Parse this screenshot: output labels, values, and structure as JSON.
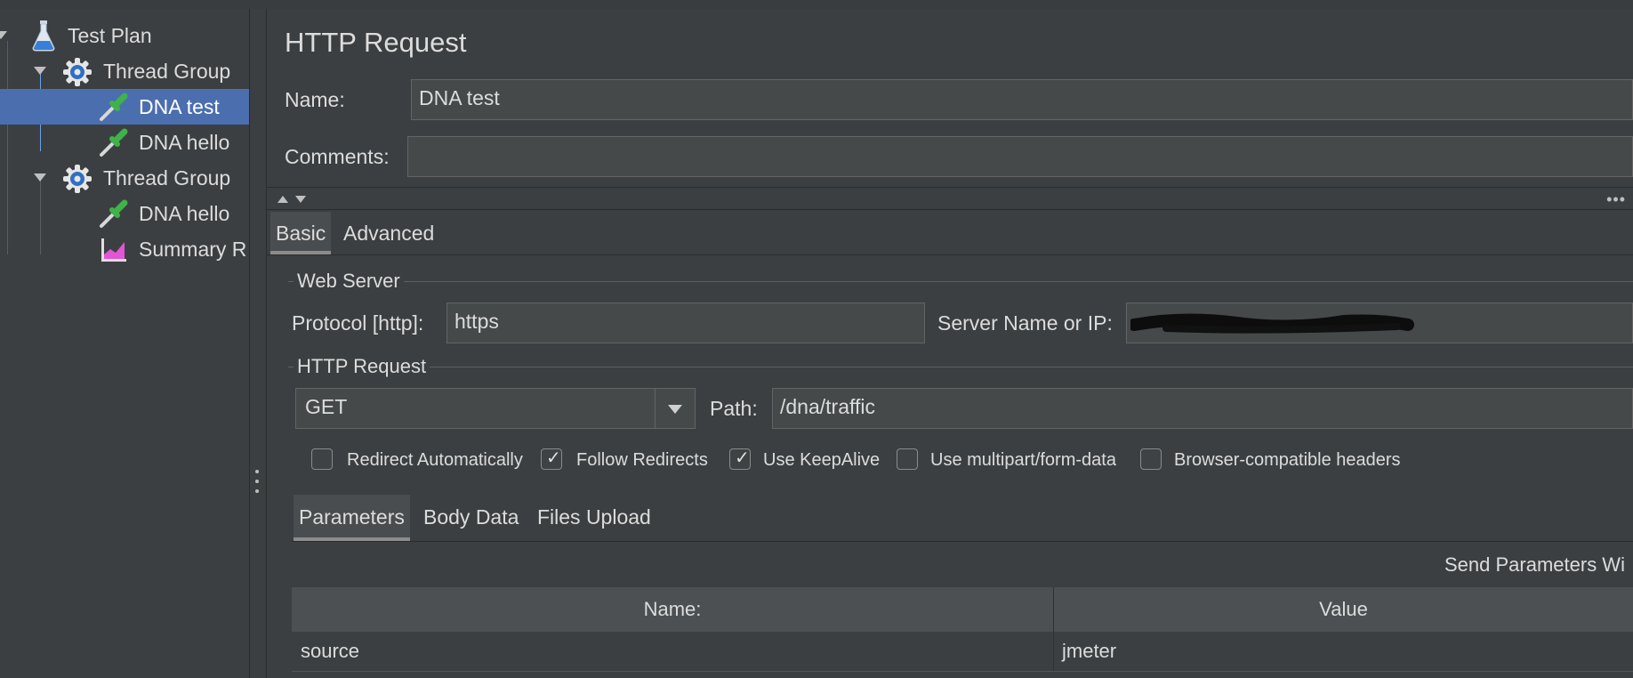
{
  "tree": {
    "items": [
      {
        "label": "Test Plan"
      },
      {
        "label": "Thread Group"
      },
      {
        "label": "DNA test"
      },
      {
        "label": "DNA hello"
      },
      {
        "label": "Thread Group"
      },
      {
        "label": "DNA hello"
      },
      {
        "label": "Summary R"
      }
    ]
  },
  "panel": {
    "title": "HTTP Request",
    "name_label": "Name:",
    "name_value": "DNA test",
    "comments_label": "Comments:",
    "comments_value": "",
    "more_glyph": "•••",
    "tabs": [
      {
        "label": "Basic",
        "active": true
      },
      {
        "label": "Advanced",
        "active": false
      }
    ],
    "web_server": {
      "legend": "Web Server",
      "protocol_label": "Protocol [http]:",
      "protocol_value": "https",
      "server_label": "Server Name or IP:"
    },
    "http_request": {
      "legend": "HTTP Request",
      "method": "GET",
      "path_label": "Path:",
      "path_value": "/dna/traffic"
    },
    "checkboxes": [
      {
        "label": "Redirect Automatically",
        "checked": false
      },
      {
        "label": "Follow Redirects",
        "checked": true
      },
      {
        "label": "Use KeepAlive",
        "checked": true
      },
      {
        "label": "Use multipart/form-data",
        "checked": false
      },
      {
        "label": "Browser-compatible headers",
        "checked": false
      }
    ],
    "sub_tabs": [
      {
        "label": "Parameters",
        "active": true
      },
      {
        "label": "Body Data",
        "active": false
      },
      {
        "label": "Files Upload",
        "active": false
      }
    ],
    "send_params_label": "Send Parameters Wi",
    "table": {
      "headers": [
        "Name:",
        "Value"
      ],
      "rows": [
        {
          "name": "source",
          "value": "jmeter"
        }
      ]
    }
  }
}
